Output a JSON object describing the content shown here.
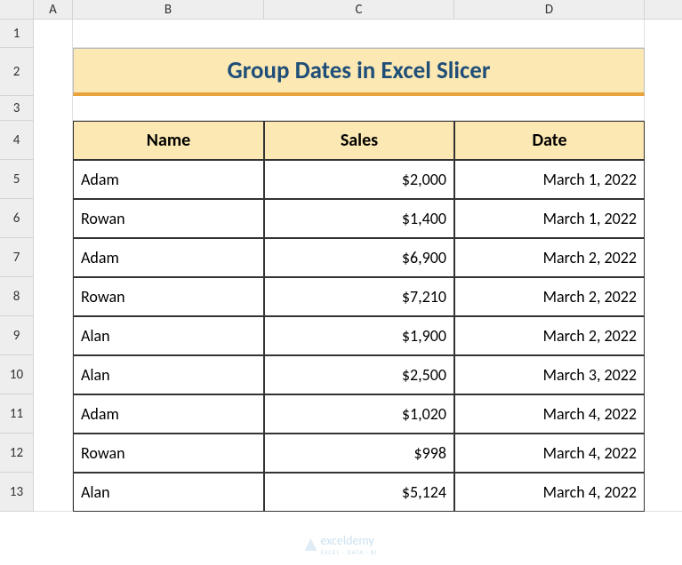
{
  "columns": [
    "A",
    "B",
    "C",
    "D"
  ],
  "rows": [
    "1",
    "2",
    "3",
    "4",
    "5",
    "6",
    "7",
    "8",
    "9",
    "10",
    "11",
    "12",
    "13"
  ],
  "title": "Group Dates in Excel Slicer",
  "headers": {
    "name": "Name",
    "sales": "Sales",
    "date": "Date"
  },
  "data": [
    {
      "name": "Adam",
      "sales": "$2,000",
      "date": "March 1, 2022"
    },
    {
      "name": "Rowan",
      "sales": "$1,400",
      "date": "March 1, 2022"
    },
    {
      "name": "Adam",
      "sales": "$6,900",
      "date": "March 2, 2022"
    },
    {
      "name": "Rowan",
      "sales": "$7,210",
      "date": "March 2, 2022"
    },
    {
      "name": "Alan",
      "sales": "$1,900",
      "date": "March 2, 2022"
    },
    {
      "name": "Alan",
      "sales": "$2,500",
      "date": "March 3, 2022"
    },
    {
      "name": "Adam",
      "sales": "$1,020",
      "date": "March 4, 2022"
    },
    {
      "name": "Rowan",
      "sales": "$998",
      "date": "March 4, 2022"
    },
    {
      "name": "Alan",
      "sales": "$5,124",
      "date": "March 4, 2022"
    }
  ],
  "watermark": {
    "brand": "exceldemy",
    "sub": "EXCEL · DATA · BI"
  }
}
